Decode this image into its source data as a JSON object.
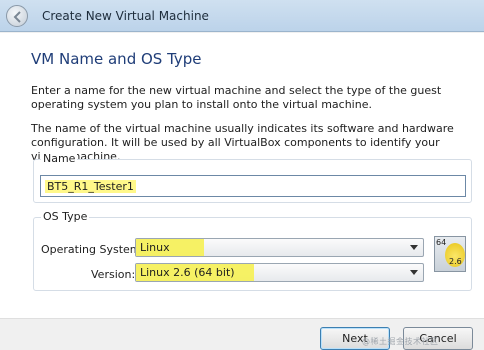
{
  "window": {
    "title": "Create New Virtual Machine"
  },
  "main": {
    "heading": "VM Name and OS Type",
    "paragraph1": "Enter a name for the new virtual machine and select the type of the guest operating system you plan to install onto the virtual machine.",
    "paragraph2": "The name of the virtual machine usually indicates its software and hardware configuration. It will be used by all VirtualBox components to identify your virtual machine."
  },
  "name_group": {
    "label": "Name",
    "value": "BT5_R1_Tester1"
  },
  "os_group": {
    "label": "OS Type",
    "os_label": "Operating System:",
    "os_value": "Linux",
    "version_label": "Version:",
    "version_value": "Linux 2.6 (64 bit)",
    "icon_bits": "64",
    "icon_version": "2.6"
  },
  "footer": {
    "next_label": "Next",
    "cancel_label": "Cancel"
  },
  "watermark": "@稀土掘金技术社区",
  "colors": {
    "highlight": "#f6f05c",
    "heading": "#1f3d78",
    "titlebar": "#cfe0f0"
  }
}
